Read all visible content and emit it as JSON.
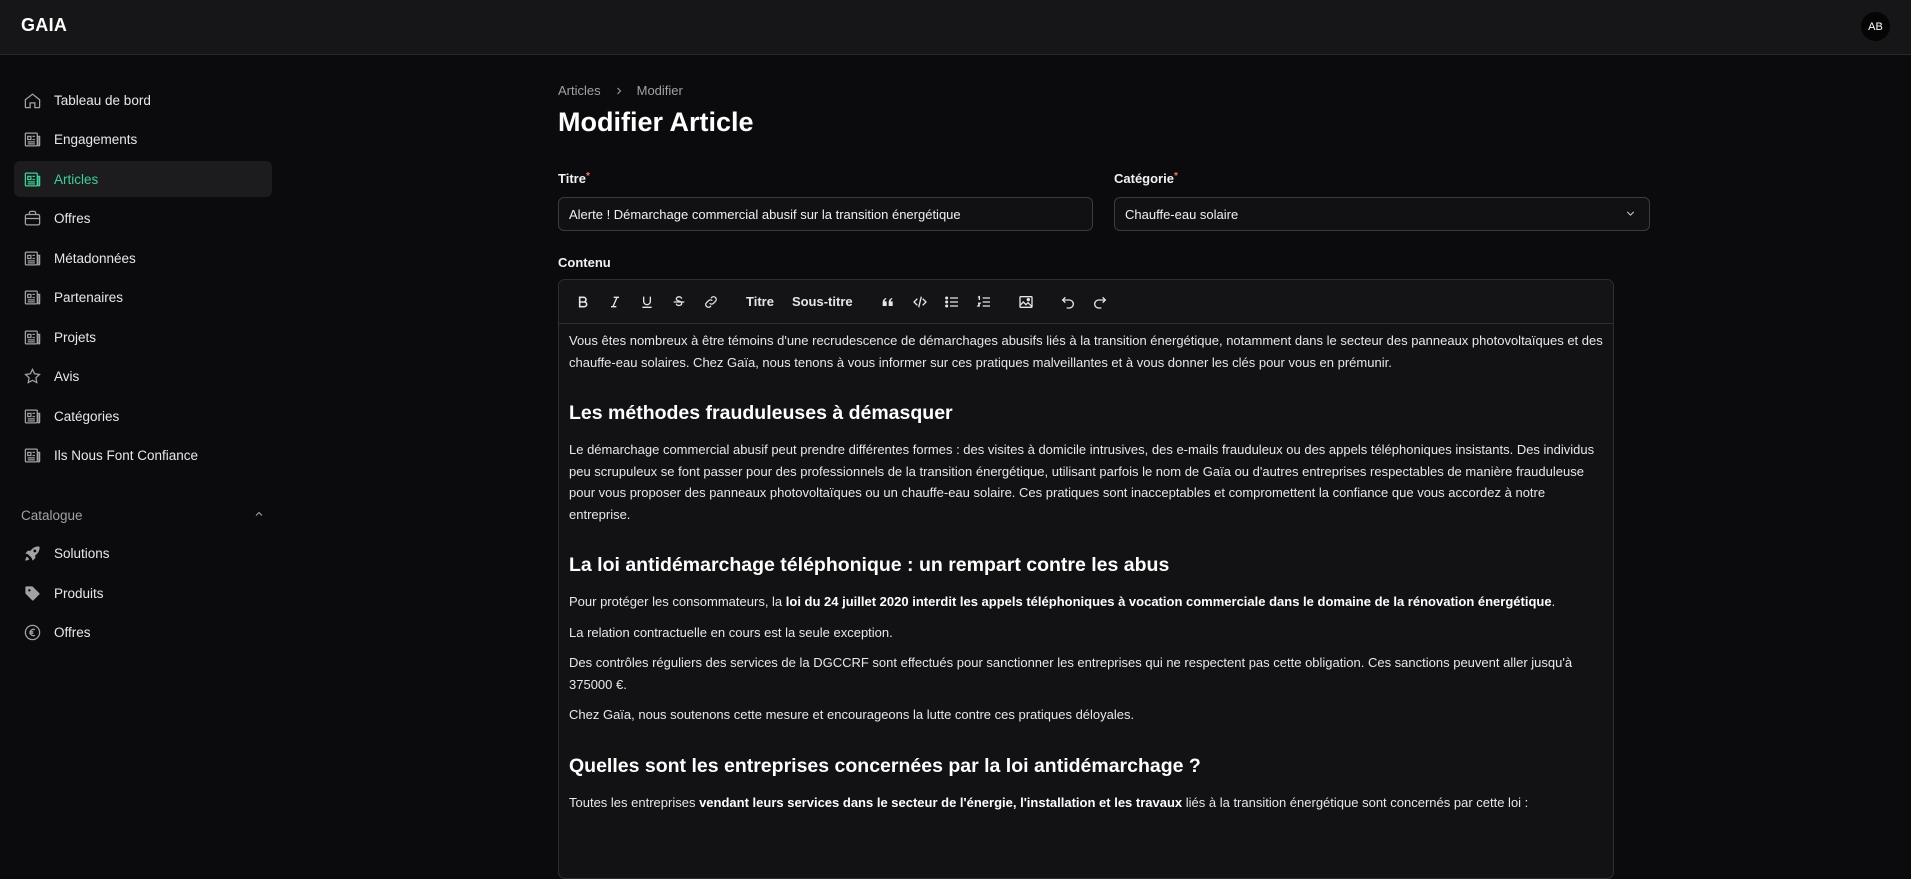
{
  "app": {
    "logo": "GAIA",
    "avatar": "AB"
  },
  "sidebar": {
    "items": [
      {
        "label": "Tableau de bord",
        "icon": "home-icon"
      },
      {
        "label": "Engagements",
        "icon": "newspaper-icon"
      },
      {
        "label": "Articles",
        "icon": "newspaper-icon",
        "active": true
      },
      {
        "label": "Offres",
        "icon": "briefcase-icon"
      },
      {
        "label": "Métadonnées",
        "icon": "newspaper-icon"
      },
      {
        "label": "Partenaires",
        "icon": "newspaper-icon"
      },
      {
        "label": "Projets",
        "icon": "newspaper-icon"
      },
      {
        "label": "Avis",
        "icon": "star-icon"
      },
      {
        "label": "Catégories",
        "icon": "newspaper-icon"
      },
      {
        "label": "Ils Nous Font Confiance",
        "icon": "newspaper-icon"
      }
    ],
    "catalogue": {
      "title": "Catalogue",
      "items": [
        {
          "label": "Solutions",
          "icon": "rocket-icon"
        },
        {
          "label": "Produits",
          "icon": "tag-icon"
        },
        {
          "label": "Offres",
          "icon": "euro-icon"
        }
      ]
    }
  },
  "breadcrumb": {
    "parent": "Articles",
    "current": "Modifier"
  },
  "page": {
    "title": "Modifier Article"
  },
  "form": {
    "title_label": "Titre",
    "title_value": "Alerte ! Démarchage commercial abusif sur la transition énergétique",
    "category_label": "Catégorie",
    "category_value": "Chauffe-eau solaire",
    "content_label": "Contenu",
    "required_mark": "*"
  },
  "toolbar": {
    "heading": "Titre",
    "subheading": "Sous-titre"
  },
  "content": {
    "p1": "Vous êtes nombreux à être témoins d'une recrudescence de démarchages abusifs liés à la transition énergétique, notamment dans le secteur des panneaux photovoltaïques et des chauffe-eau solaires. Chez Gaïa, nous tenons à vous informer sur ces pratiques malveillantes et à vous donner les clés pour vous en prémunir.",
    "h1": "Les méthodes frauduleuses à démasquer",
    "p2": "Le démarchage commercial abusif peut prendre différentes formes : des visites à domicile intrusives, des e-mails frauduleux ou des appels téléphoniques insistants. Des individus peu scrupuleux se font passer pour des professionnels de la transition énergétique, utilisant parfois le nom de Gaïa ou d'autres entreprises respectables de manière frauduleuse pour vous proposer des panneaux photovoltaïques ou un chauffe-eau solaire. Ces pratiques sont inacceptables et compromettent la confiance que vous accordez à notre entreprise.",
    "h2": "La loi antidémarchage téléphonique : un rempart contre les abus",
    "p3_pre": "Pour protéger les consommateurs, la ",
    "p3_bold": "loi du 24 juillet 2020 interdit les appels téléphoniques à vocation commerciale dans le domaine de la rénovation énergétique",
    "p3_post": ".",
    "p4": "La relation contractuelle en cours est la seule exception.",
    "p5": "Des contrôles réguliers des services de la DGCCRF sont effectués pour sanctionner les entreprises qui ne respectent pas cette obligation. Ces sanctions peuvent aller jusqu'à 375000 €.",
    "p6": "Chez Gaïa, nous soutenons cette mesure et encourageons la lutte contre ces pratiques déloyales.",
    "h3": "Quelles sont les entreprises concernées par la loi antidémarchage ?",
    "p7_pre": "Toutes les entreprises ",
    "p7_bold": "vendant leurs services dans le secteur de l'énergie, l'installation et les travaux",
    "p7_post": " liés à la transition énergétique sont concernés par cette loi :"
  }
}
